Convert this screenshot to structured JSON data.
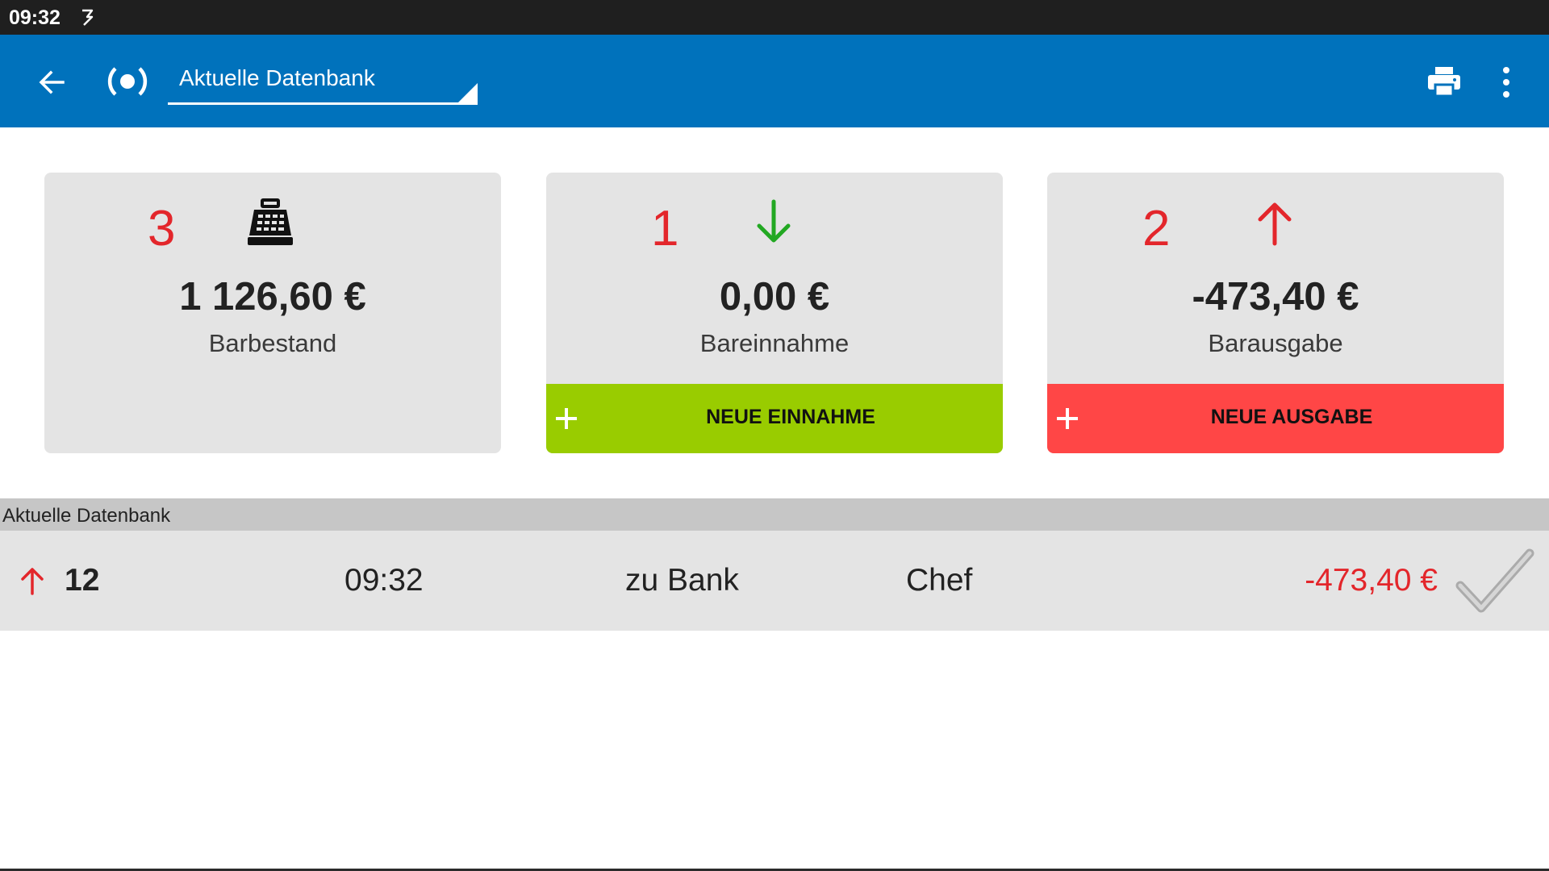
{
  "status_bar": {
    "time": "09:32",
    "notification_icon": "signature-icon"
  },
  "app_bar": {
    "back_icon": "arrow-left-icon",
    "live_icon": "broadcast-icon",
    "database_select": "Aktuelle Datenbank",
    "print_icon": "printer-icon",
    "more_icon": "more-vert-icon",
    "background": "#0072bc"
  },
  "cards": {
    "balance": {
      "number": "3",
      "icon": "cash-register-icon",
      "amount": "1 126,60 €",
      "label": "Barbestand"
    },
    "income": {
      "number": "1",
      "icon": "arrow-down-icon",
      "amount": "0,00 €",
      "label": "Bareinnahme",
      "button_label": "NEUE EINNAHME",
      "button_color": "#99cc00"
    },
    "expense": {
      "number": "2",
      "icon": "arrow-up-icon",
      "amount": "-473,40 €",
      "label": "Barausgabe",
      "button_label": "NEUE AUSGABE",
      "button_color": "#ff4646"
    }
  },
  "list": {
    "section_title": "Aktuelle Datenbank",
    "rows": [
      {
        "direction_icon": "arrow-up-icon",
        "number": "12",
        "time": "09:32",
        "description": "zu Bank",
        "user": "Chef",
        "amount": "-473,40 €",
        "status_icon": "checkmark-icon"
      }
    ]
  },
  "colors": {
    "red": "#e3262b",
    "green": "#22a822",
    "card_bg": "#e4e4e4"
  }
}
